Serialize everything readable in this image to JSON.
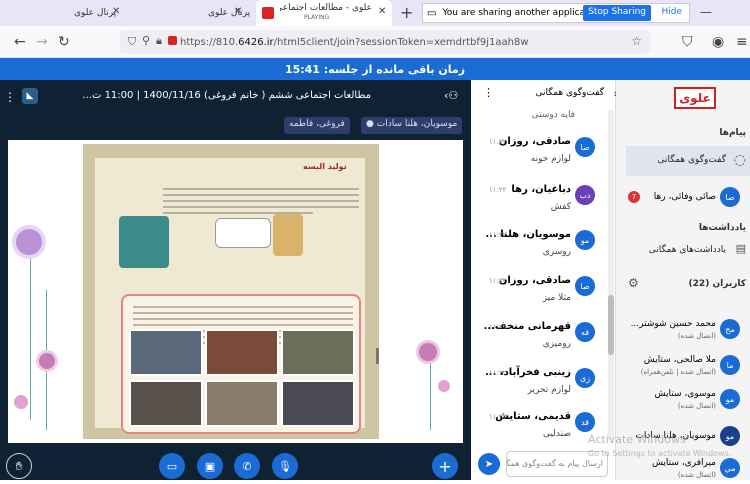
{
  "browser": {
    "tabs": [
      {
        "title": "پرتال علوی"
      },
      {
        "title": "پرتال علوی"
      },
      {
        "title": "علوی - مطالعات اجتماعی شش...",
        "sub": "PLAYING"
      }
    ],
    "share_notice": "You are sharing another application window.",
    "stop_sharing": "Stop Sharing",
    "hide": "Hide",
    "url_prefix": "https://810.",
    "url_domain": "6426.ir",
    "url_rest": "/html5client/join?sessionToken=xemdrtbf9j1aah8w"
  },
  "timer": "زمان باقی مانده از جلسه: 15:41",
  "presentation": {
    "title": "مطالعات اجتماعی ششم ( خانم فروغی) 1400/11/16 | 11:00 ت...",
    "presenter_chips": [
      "موسویان، هلنا سادات",
      "فروغی، فاطمه"
    ],
    "book_heading": "تولید البسه"
  },
  "chat": {
    "title": "گفت‌وگوی همگانی",
    "top_text": "فایه دوستی",
    "messages": [
      {
        "initials": "صا",
        "name": "صادقی، روزان",
        "time": "۱۱:۲۲",
        "text": "لوازم خونه",
        "color": "#1b6bd4"
      },
      {
        "initials": "دب",
        "name": "دباغیان، رها",
        "time": "۱۱:۲۲",
        "text": "کفش",
        "color": "#6b3fb8"
      },
      {
        "initials": "مو",
        "name": "موسویان، هلنا ...",
        "time": "۱۱:۲۲",
        "text": "روسری",
        "color": "#1b6bd4"
      },
      {
        "initials": "صا",
        "name": "صادقی، روزان",
        "time": "۱۱:۲۲",
        "text": "مثلا میز",
        "color": "#1b6bd4"
      },
      {
        "initials": "قه",
        "name": "قهرمانی منخف...",
        "time": "۱۱:۲۲",
        "text": "رومیزی",
        "color": "#1b6bd4"
      },
      {
        "initials": "زی",
        "name": "زینبی فخرآباد، ...",
        "time": "۱۱:۲۲",
        "text": "لوازم تحریر",
        "color": "#1b6bd4"
      },
      {
        "initials": "قد",
        "name": "قدیمی، ستایش",
        "time": "۱۱:۲۲",
        "text": "صندلیی",
        "color": "#1b6bd4"
      }
    ],
    "input_placeholder": "ارسال پیام به گفت‌وگوی همگانی"
  },
  "side": {
    "logo": "علوی",
    "messages_header": "پیام‌ها",
    "public_chat": "گفت‌وگوی همگانی",
    "private_chat_name": "صائی وفائی، رها",
    "private_unread": "7",
    "private_initials": "صا",
    "notes_header": "یادداشت‌ها",
    "shared_notes": "یادداشت‌های همگانی",
    "users_header": "کاربران (22)",
    "users": [
      {
        "initials": "مح",
        "name": "محمد حسین شوشتر...",
        "status": "(اتصال شده)",
        "color": "#1b6bd4"
      },
      {
        "initials": "ما",
        "name": "ملا صالحی، ستایش",
        "status": "(اتصال شده | تلفن‌همراه)",
        "color": "#1b6bd4"
      },
      {
        "initials": "مو",
        "name": "موسوی، ستایش",
        "status": "(اتصال شده)",
        "color": "#1b6bd4"
      },
      {
        "initials": "مو",
        "name": "موسویان، هلنا سادات",
        "status": "",
        "color": "#1b3f8a"
      },
      {
        "initials": "مي",
        "name": "میرافری، ستایش",
        "status": "(اتصال شده)",
        "color": "#1b6bd4"
      }
    ]
  },
  "os": {
    "watermark_title": "Activate Windows",
    "watermark_sub": "Go to Settings to activate Windows."
  }
}
